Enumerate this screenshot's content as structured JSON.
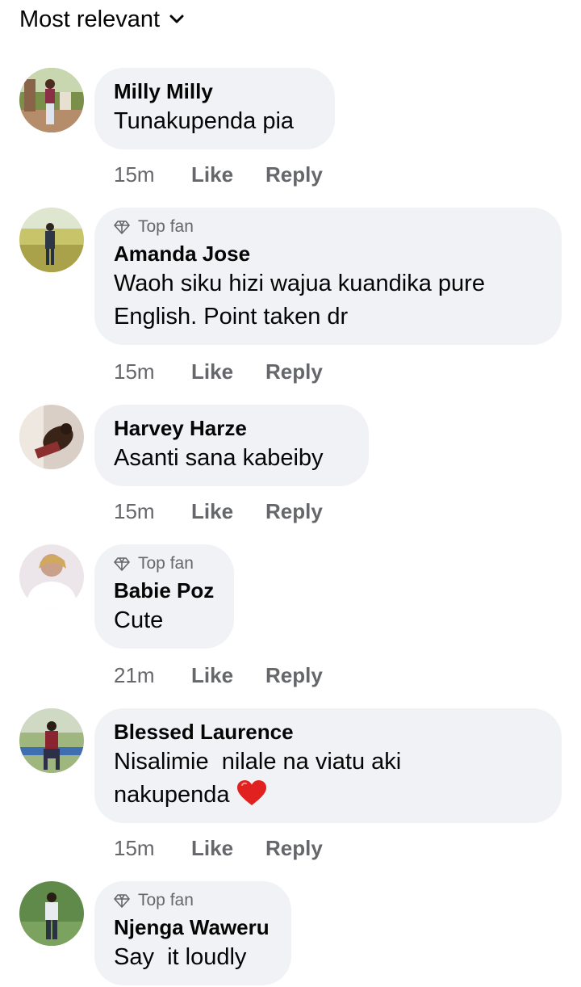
{
  "sort": {
    "label": "Most relevant",
    "icon": "chevron-down-icon"
  },
  "badge_icon": "diamond-icon",
  "comments": [
    {
      "author": "Milly Milly",
      "badge": "",
      "text": "Tunakupenda pia",
      "time": "15m",
      "like": "Like",
      "reply": "Reply"
    },
    {
      "author": "Amanda Jose",
      "badge": "Top fan",
      "text": "Waoh siku hizi wajua kuandika pure\nEnglish. Point taken dr",
      "time": "15m",
      "like": "Like",
      "reply": "Reply"
    },
    {
      "author": "Harvey Harze",
      "badge": "",
      "text": "Asanti sana kabeiby",
      "time": "15m",
      "like": "Like",
      "reply": "Reply"
    },
    {
      "author": "Babie Poz",
      "badge": "Top fan",
      "text": "Cute",
      "time": "21m",
      "like": "Like",
      "reply": "Reply"
    },
    {
      "author": "Blessed Laurence",
      "badge": "",
      "text": "Nisalimie  nilale na viatu aki\nnakupenda",
      "emoji": "heart-emoji",
      "time": "15m",
      "like": "Like",
      "reply": "Reply"
    },
    {
      "author": "Njenga Waweru",
      "badge": "Top fan",
      "text": "Say  it loudly",
      "time": "",
      "like": "",
      "reply": ""
    }
  ]
}
